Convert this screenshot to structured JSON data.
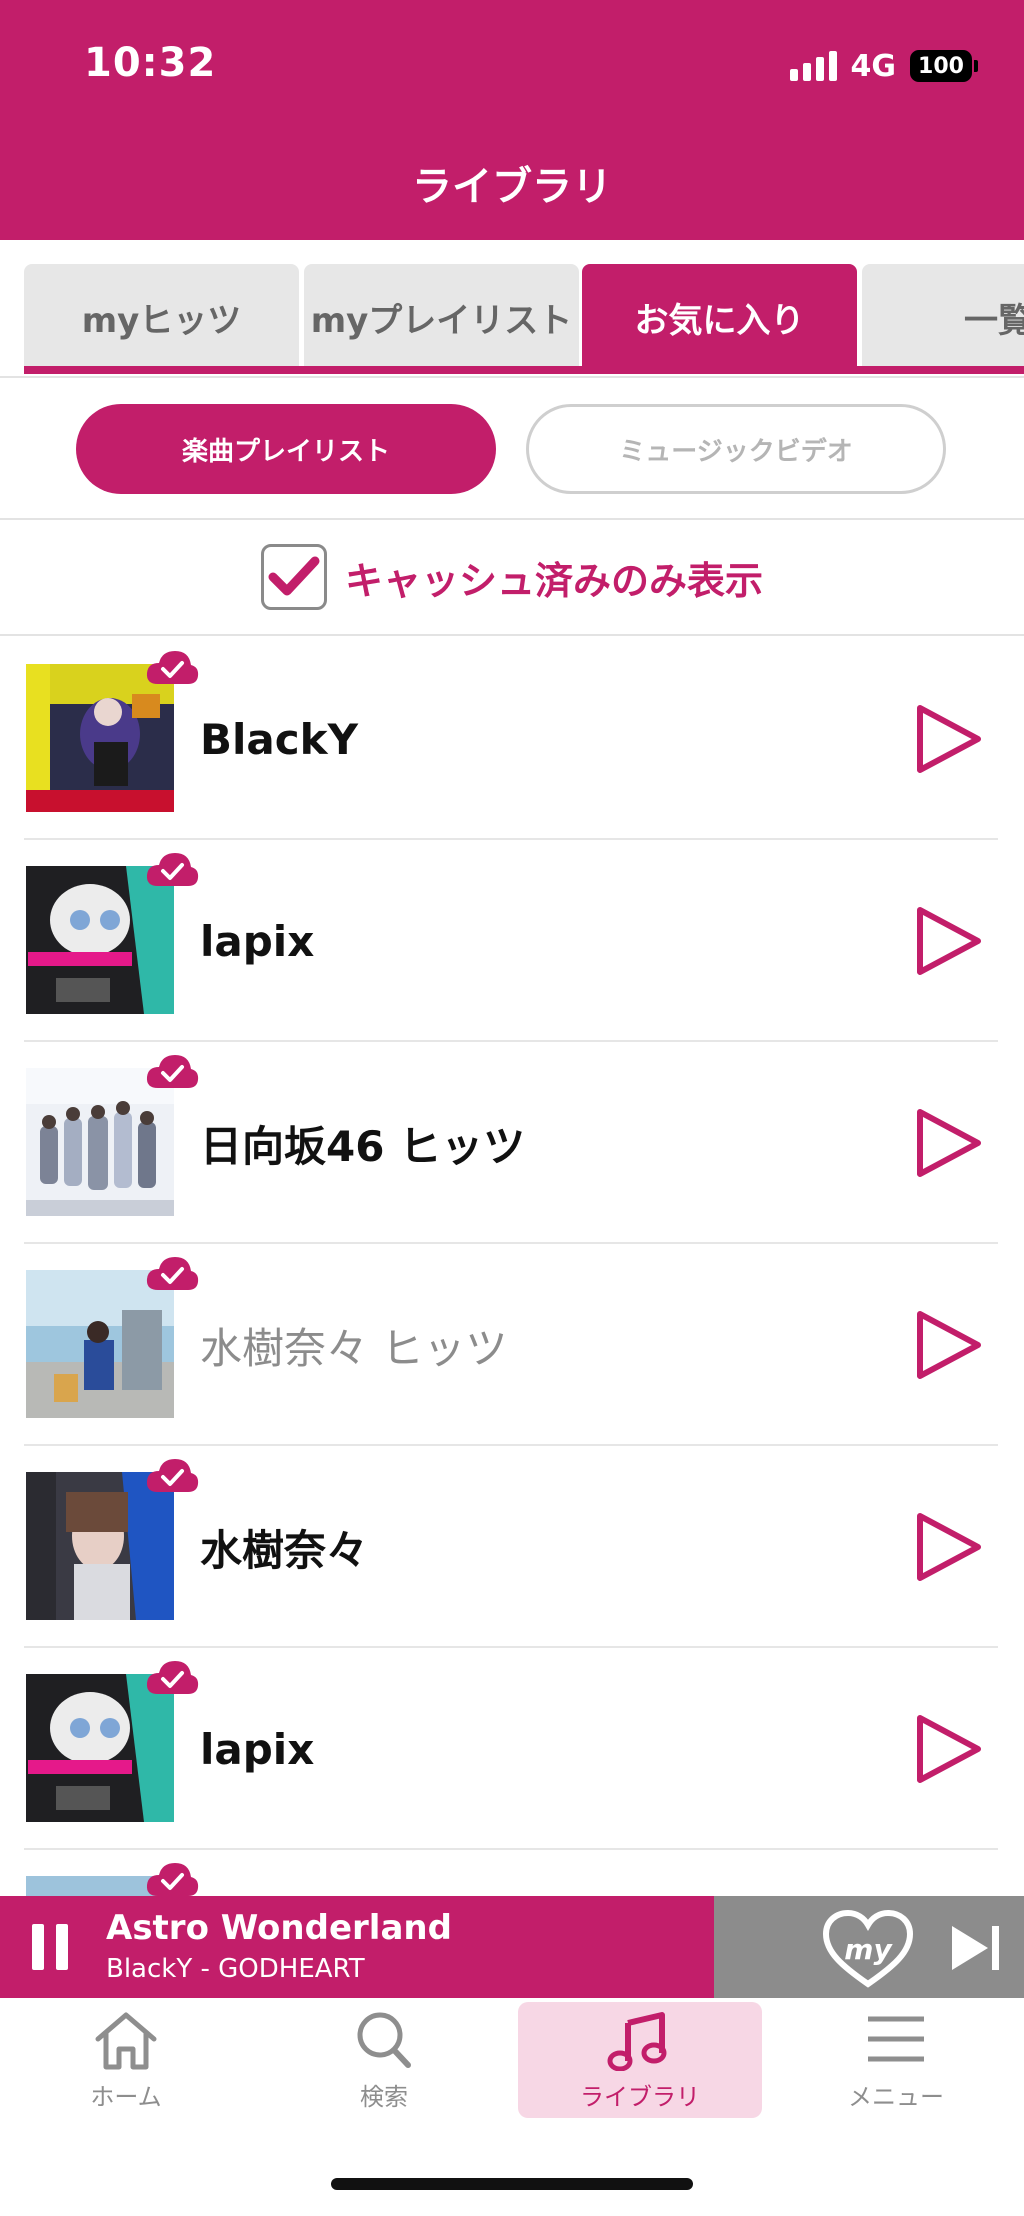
{
  "status_bar": {
    "time": "10:32",
    "network": "4G",
    "battery": "100"
  },
  "header": {
    "title": "ライブラリ"
  },
  "tabs": [
    {
      "label": "myヒッツ"
    },
    {
      "label": "myプレイリスト"
    },
    {
      "label": "お気に入り",
      "active": true
    },
    {
      "label": "一覧"
    }
  ],
  "segments": {
    "playlist": "楽曲プレイリスト",
    "video": "ミュージックビデオ"
  },
  "filter": {
    "label": "キャッシュ済みのみ表示",
    "checked": true
  },
  "playlists": [
    {
      "title": "BlackY",
      "cached": true
    },
    {
      "title": "lapix",
      "cached": true
    },
    {
      "title": "日向坂46 ヒッツ",
      "cached": true
    },
    {
      "title": "水樹奈々 ヒッツ",
      "cached": true,
      "dimmed": true
    },
    {
      "title": "水樹奈々",
      "cached": true
    },
    {
      "title": "lapix",
      "cached": true
    }
  ],
  "now_playing": {
    "title": "Astro Wonderland",
    "artist": "BlackY - GODHEART",
    "heart_label": "my"
  },
  "bottom_nav": [
    {
      "label": "ホーム",
      "icon": "home-icon"
    },
    {
      "label": "検索",
      "icon": "search-icon"
    },
    {
      "label": "ライブラリ",
      "icon": "music-note-icon",
      "active": true
    },
    {
      "label": "メニュー",
      "icon": "menu-icon"
    }
  ],
  "colors": {
    "brand": "#C21E6A",
    "tab_inactive": "#e7e7e7",
    "player_gray": "#8c8c8c",
    "nav_active_bg": "#f7d7e5"
  }
}
